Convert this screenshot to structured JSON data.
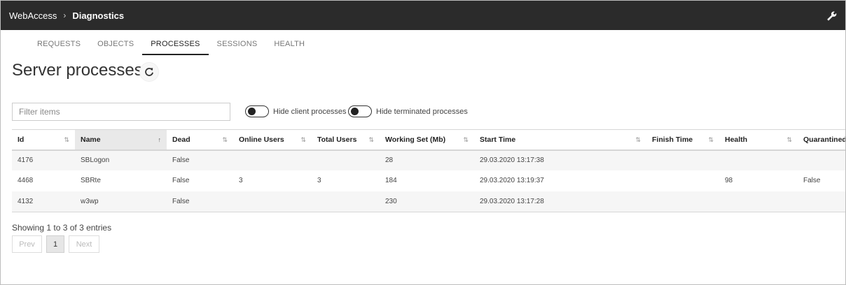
{
  "breadcrumb": {
    "root": "WebAccess",
    "separator": "›",
    "current": "Diagnostics"
  },
  "toolbar": {
    "settings_icon": "wrench-icon"
  },
  "tabs": [
    {
      "label": "REQUESTS",
      "active": false
    },
    {
      "label": "OBJECTS",
      "active": false
    },
    {
      "label": "PROCESSES",
      "active": true
    },
    {
      "label": "SESSIONS",
      "active": false
    },
    {
      "label": "HEALTH",
      "active": false
    }
  ],
  "page": {
    "title": "Server processes",
    "refresh_icon": "refresh-icon"
  },
  "filter": {
    "placeholder": "Filter items",
    "value": ""
  },
  "toggles": {
    "hide_client": {
      "label": "Hide client processes",
      "on": false
    },
    "hide_terminated": {
      "label": "Hide terminated processes",
      "on": false
    }
  },
  "table": {
    "columns": [
      {
        "label": "Id",
        "sort": "⇅"
      },
      {
        "label": "Name",
        "sort": "↑"
      },
      {
        "label": "Dead",
        "sort": "⇅"
      },
      {
        "label": "Online Users",
        "sort": "⇅"
      },
      {
        "label": "Total Users",
        "sort": "⇅"
      },
      {
        "label": "Working Set (Mb)",
        "sort": "⇅"
      },
      {
        "label": "Start Time",
        "sort": "⇅"
      },
      {
        "label": "Finish Time",
        "sort": "⇅"
      },
      {
        "label": "Health",
        "sort": "⇅"
      },
      {
        "label": "Quarantined",
        "sort": ""
      }
    ],
    "rows": [
      [
        "4176",
        "SBLogon",
        "False",
        "",
        "",
        "28",
        "29.03.2020 13:17:38",
        "",
        "",
        ""
      ],
      [
        "4468",
        "SBRte",
        "False",
        "3",
        "3",
        "184",
        "29.03.2020 13:19:37",
        "",
        "98",
        "False"
      ],
      [
        "4132",
        "w3wp",
        "False",
        "",
        "",
        "230",
        "29.03.2020 13:17:28",
        "",
        "",
        ""
      ]
    ]
  },
  "info": "Showing 1 to 3 of 3 entries",
  "pagination": {
    "prev": "Prev",
    "page": "1",
    "next": "Next"
  },
  "colors": {
    "topbar": "#2b2b2b",
    "active_tab_underline": "#222222",
    "sorted_header": "#e9e9e9",
    "zebra": "#f6f6f6"
  }
}
